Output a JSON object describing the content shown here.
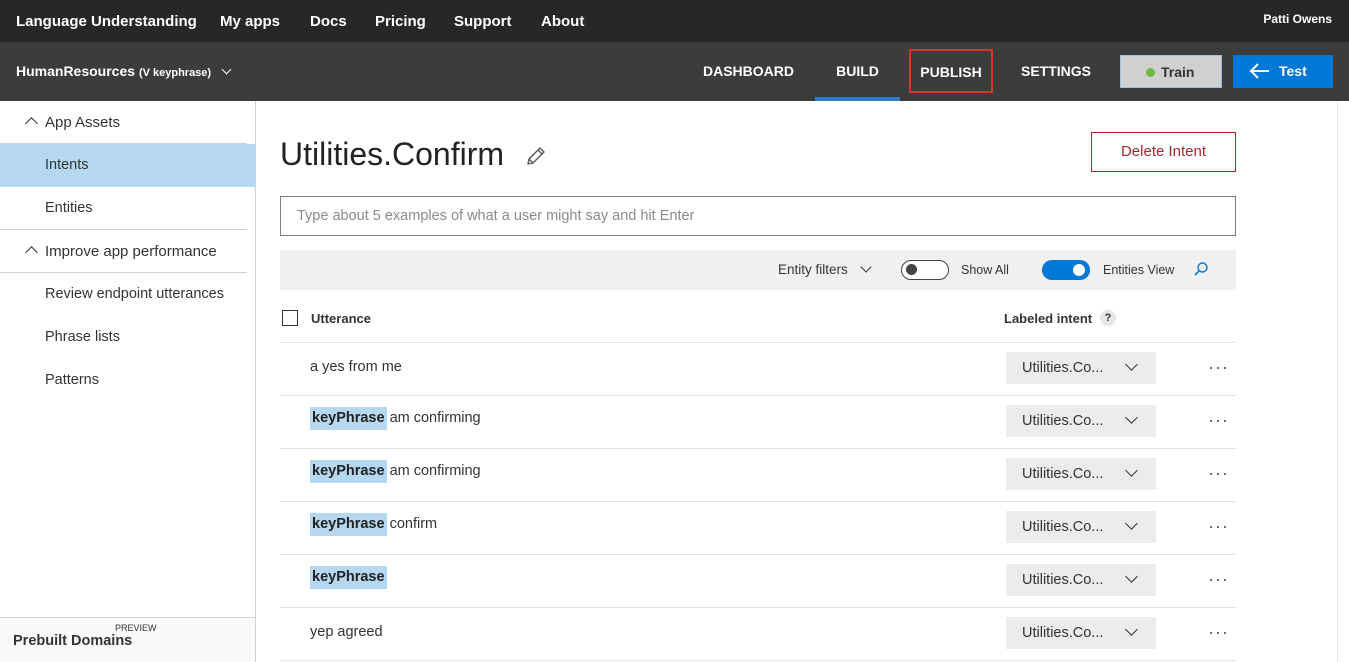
{
  "topnav": {
    "items": [
      "Language Understanding",
      "My apps",
      "Docs",
      "Pricing",
      "Support",
      "About"
    ],
    "user": "Patti Owens"
  },
  "appbar": {
    "app_name": "HumanResources",
    "version": "(V keyphrase)",
    "tabs": [
      "DASHBOARD",
      "BUILD",
      "PUBLISH",
      "SETTINGS"
    ],
    "active_tab": "BUILD",
    "highlighted_tab": "PUBLISH",
    "train_label": "Train",
    "test_label": "Test"
  },
  "sidebar": {
    "app_assets": "App Assets",
    "intents": "Intents",
    "entities": "Entities",
    "improve": "Improve app performance",
    "review": "Review endpoint utterances",
    "phrase_lists": "Phrase lists",
    "patterns": "Patterns",
    "prebuilt_preview": "PREVIEW",
    "prebuilt_domains": "Prebuilt Domains"
  },
  "main": {
    "title": "Utilities.Confirm",
    "delete_label": "Delete Intent",
    "input_placeholder": "Type about 5 examples of what a user might say and hit Enter",
    "entity_filters": "Entity filters",
    "show_all": "Show All",
    "entities_view": "Entities View",
    "col_utterance": "Utterance",
    "col_intent": "Labeled intent",
    "help": "?",
    "rows": [
      {
        "entity": "",
        "text": "a yes from me",
        "intent": "Utilities.Co..."
      },
      {
        "entity": "keyPhrase",
        "text": "am confirming",
        "intent": "Utilities.Co..."
      },
      {
        "entity": "keyPhrase",
        "text": "am confirming",
        "intent": "Utilities.Co..."
      },
      {
        "entity": "keyPhrase",
        "text": "confirm",
        "intent": "Utilities.Co..."
      },
      {
        "entity": "keyPhrase",
        "text": "",
        "intent": "Utilities.Co..."
      },
      {
        "entity": "",
        "text": "yep agreed",
        "intent": "Utilities.Co..."
      }
    ],
    "more": "···"
  },
  "colors": {
    "topnav_bg": "#272727",
    "appbar_bg": "#3c3c3c",
    "accent": "#0078d7",
    "entity_chip": "#b5d7f0",
    "delete_red": "#a4262c",
    "publish_outline": "#d9342b"
  }
}
